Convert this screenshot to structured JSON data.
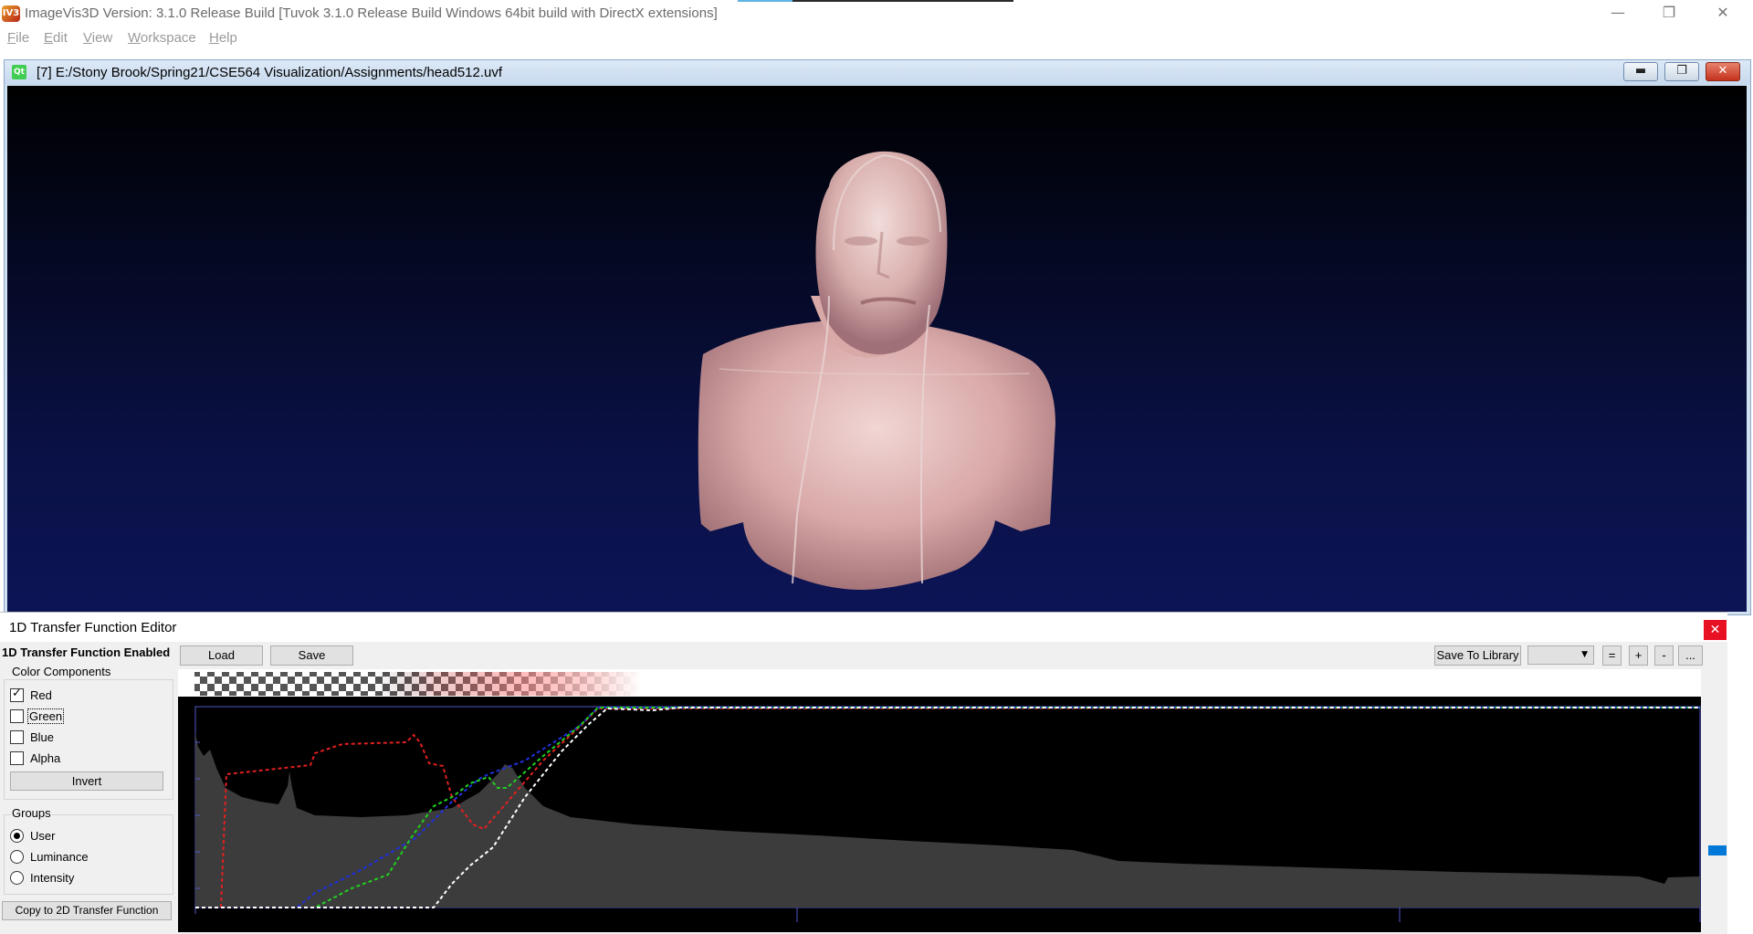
{
  "window": {
    "app_icon_text": "IV3",
    "title": "ImageVis3D Version: 3.1.0 Release Build [Tuvok 3.1.0 Release Build Windows 64bit build with DirectX extensions]",
    "minimize_glyph": "—",
    "restore_glyph": "❐",
    "close_glyph": "✕"
  },
  "menu": [
    {
      "first": "F",
      "rest": "ile"
    },
    {
      "first": "E",
      "rest": "dit"
    },
    {
      "first": "V",
      "rest": "iew"
    },
    {
      "first": "W",
      "rest": "orkspace"
    },
    {
      "first": "H",
      "rest": "elp"
    }
  ],
  "subwindow": {
    "icon_text": "Qt",
    "title": "[7] E:/Stony Brook/Spring21/CSE564 Visualization/Assignments/head512.uvf",
    "minimize_glyph": "▬",
    "maximize_glyph": "❐",
    "close_glyph": "✕",
    "render_background_colors": [
      "#000000",
      "#0c1456"
    ],
    "render_subject": "volume-rendered head and torso"
  },
  "tf_editor": {
    "title": "1D Transfer Function Editor",
    "close_glyph": "✕",
    "enabled_label": "1D Transfer Function Enabled",
    "load_label": "Load",
    "save_label": "Save",
    "save_to_library_label": "Save To Library",
    "preset_selected": "",
    "equals_label": "=",
    "plus_label": "+",
    "minus_label": "-",
    "more_label": "...",
    "color_components": {
      "title": "Color Components",
      "red": {
        "label": "Red",
        "checked": true
      },
      "green": {
        "label": "Green",
        "checked": false
      },
      "blue": {
        "label": "Blue",
        "checked": false
      },
      "alpha": {
        "label": "Alpha",
        "checked": false
      }
    },
    "invert_label": "Invert",
    "groups": {
      "title": "Groups",
      "options": [
        {
          "label": "User",
          "selected": true
        },
        {
          "label": "Luminance",
          "selected": false
        },
        {
          "label": "Intensity",
          "selected": false
        }
      ]
    },
    "copy_2d_label": "Copy to 2D Transfer Function",
    "colors": {
      "red_curve": "#e02020",
      "green_curve": "#20d020",
      "blue_curve": "#2030e0",
      "alpha_curve": "#ffffff",
      "histogram": "#3c3c3c",
      "graph_background": "#000000",
      "graph_border": "#5058c8",
      "scroll_thumb": "#0078d7"
    }
  }
}
